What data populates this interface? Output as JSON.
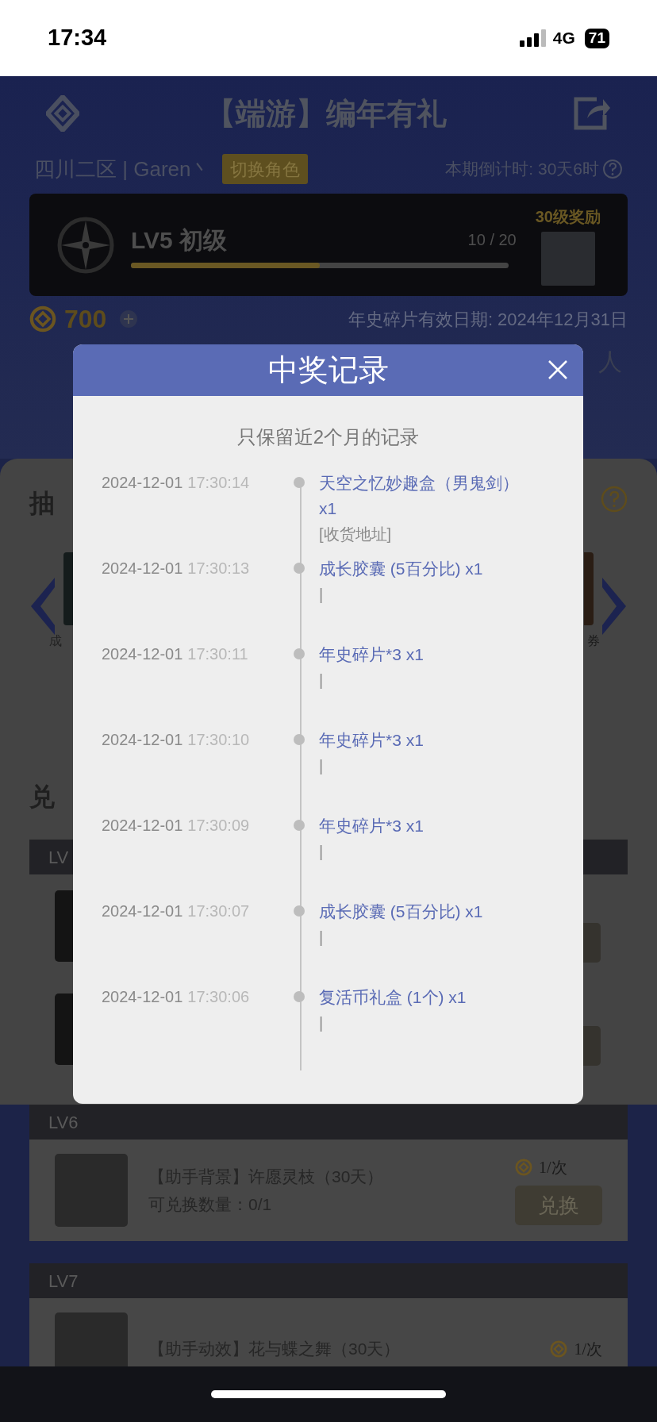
{
  "status_bar": {
    "time": "17:34",
    "network": "4G",
    "battery": "71"
  },
  "header": {
    "title": "【端游】编年有礼"
  },
  "user": {
    "server_role": "四川二区 | Garen丶",
    "switch_button": "切换角色",
    "countdown": "本期倒计时: 30天6时"
  },
  "level_card": {
    "level_label": "LV5 初级",
    "progress": "10 / 20",
    "level": 0.5,
    "reward_label": "30级奖励"
  },
  "coins": {
    "amount": "700",
    "expiry": "年史碎片有效日期: 2024年12月31日"
  },
  "partial_texts": {
    "right_fragment": "人",
    "draw_heading": "抽",
    "prize_left": "成",
    "prize_right": "券",
    "exchange_heading": "兑",
    "level_strip": "LV"
  },
  "modal": {
    "title": "中奖记录",
    "subtitle": "只保留近2个月的记录",
    "records": [
      {
        "date": "2024-12-01",
        "time": "17:30:14",
        "item": "天空之忆妙趣盒（男鬼剑）x1",
        "note": "[收货地址]"
      },
      {
        "date": "2024-12-01",
        "time": "17:30:13",
        "item": "成长胶囊 (5百分比) x1",
        "note": "|"
      },
      {
        "date": "2024-12-01",
        "time": "17:30:11",
        "item": "年史碎片*3 x1",
        "note": "|"
      },
      {
        "date": "2024-12-01",
        "time": "17:30:10",
        "item": "年史碎片*3 x1",
        "note": "|"
      },
      {
        "date": "2024-12-01",
        "time": "17:30:09",
        "item": "年史碎片*3 x1",
        "note": "|"
      },
      {
        "date": "2024-12-01",
        "time": "17:30:07",
        "item": "成长胶囊 (5百分比) x1",
        "note": "|"
      },
      {
        "date": "2024-12-01",
        "time": "17:30:06",
        "item": "复活币礼盒 (1个) x1",
        "note": "|"
      }
    ]
  },
  "exchange_sections": [
    {
      "level": "LV6",
      "name": "【助手背景】许愿灵枝（30天）",
      "quota": "可兑换数量：0/1",
      "price": "1/次",
      "button": "兑换"
    },
    {
      "level": "LV7",
      "name": "【助手动效】花与蝶之舞（30天）",
      "price": "1/次"
    }
  ]
}
